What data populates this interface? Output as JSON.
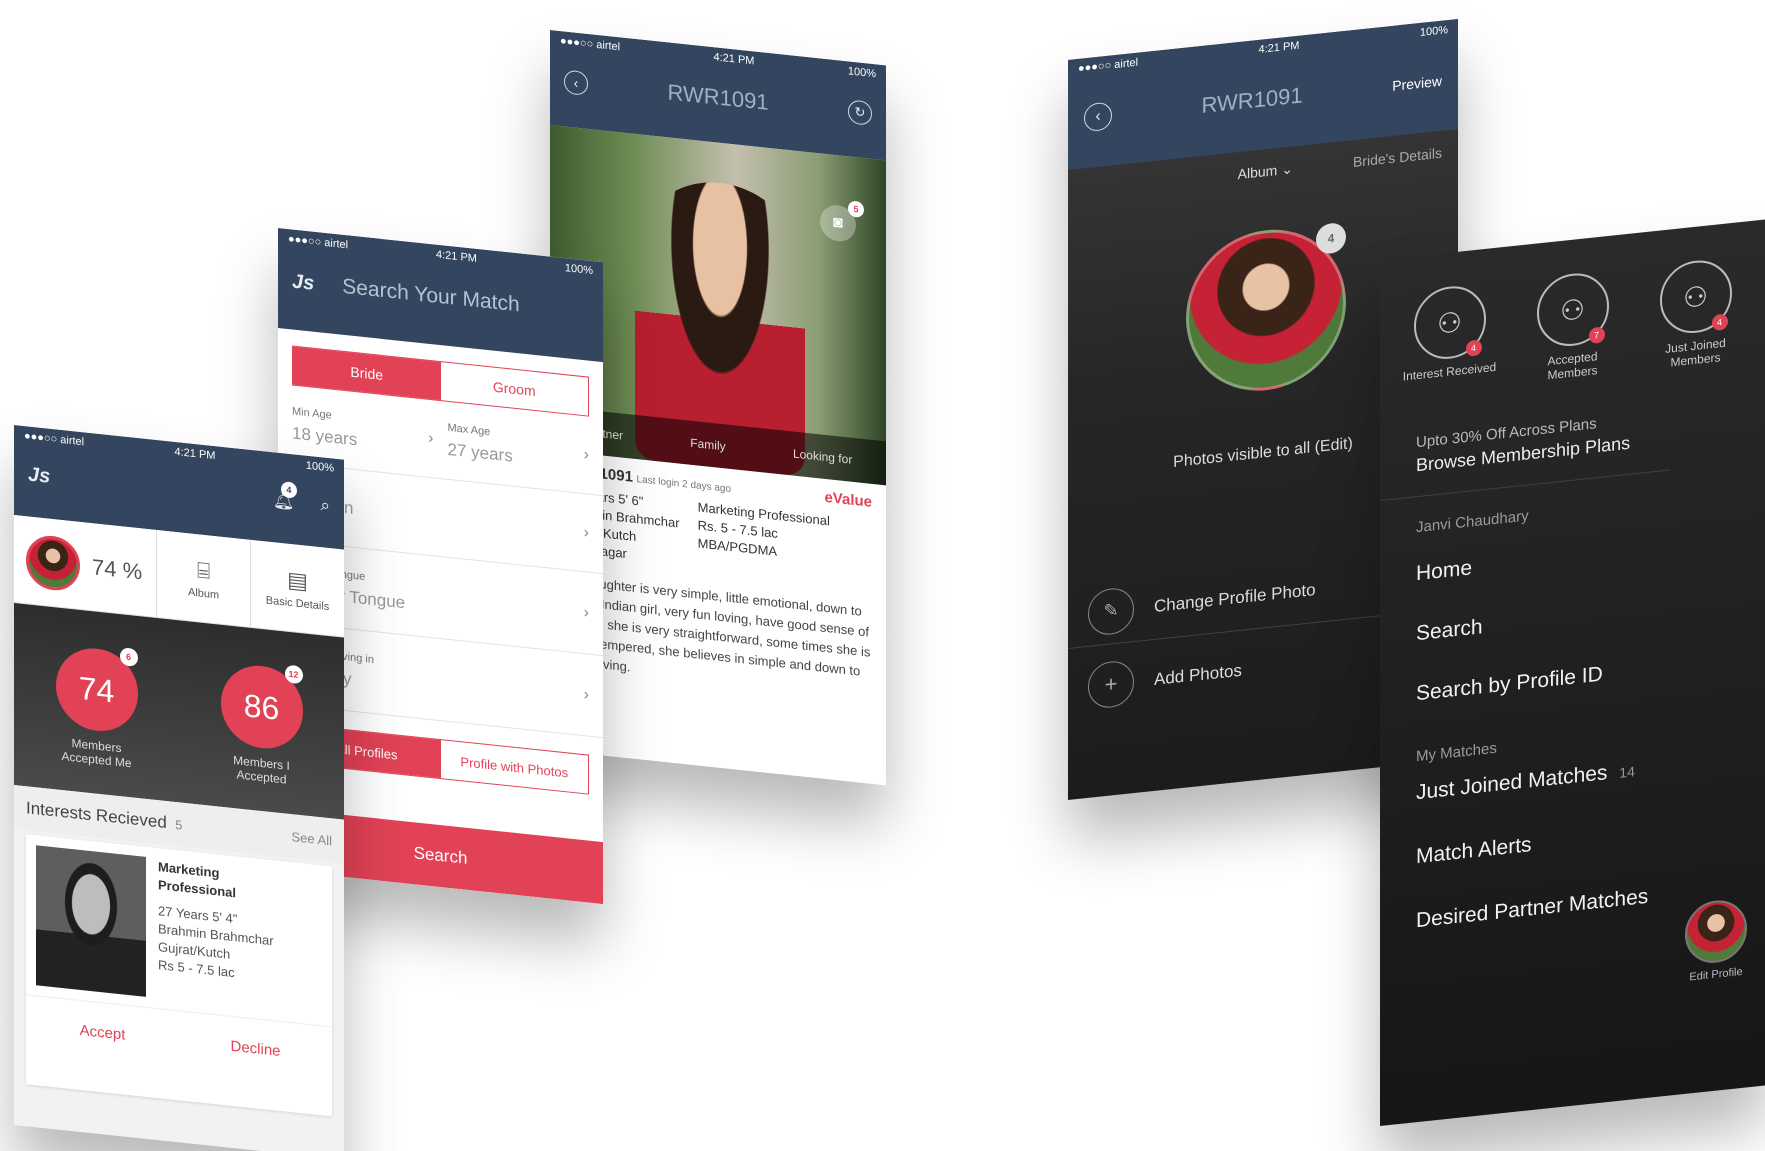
{
  "status": {
    "carrier": "●●●○○ airtel",
    "time": "4:21 PM",
    "battery": "100%"
  },
  "dashboard": {
    "logo": "Js",
    "notif_count": "4",
    "completion": "74 %",
    "album_label": "Album",
    "basic_label": "Basic Details",
    "accepted_me": {
      "value": "74",
      "badge": "6",
      "label": "Members Accepted Me"
    },
    "i_accepted": {
      "value": "86",
      "badge": "12",
      "label": "Members I Accepted"
    },
    "interests_title": "Interests Recieved",
    "interests_count": "5",
    "see_all": "See All",
    "card": {
      "profession": "Marketing Professional",
      "line1": "27 Years   5' 4\"",
      "line2": "Brahmin Brahmchar",
      "line3": "Gujrat/Kutch",
      "line4": "Rs 5 - 7.5 lac",
      "accept": "Accept",
      "decline": "Decline"
    }
  },
  "search": {
    "logo": "Js",
    "title": "Search Your Match",
    "bride": "Bride",
    "groom": "Groom",
    "min_age_label": "Min Age",
    "min_age_value": "18 years",
    "max_age_label": "Max Age",
    "max_age_value": "27 years",
    "religion": "Religion",
    "tongue_label": "Mother Tongue",
    "tongue_value": "Mother Tongue",
    "country_label": "Country Living in",
    "country_value": "Country",
    "all_profiles": "All Profiles",
    "with_photos": "Profile with Photos",
    "search_button": "Search"
  },
  "profile": {
    "id": "RWR1091",
    "photo_count": "5",
    "tabs": [
      "Partner",
      "Family",
      "Looking for"
    ],
    "id_line": "RWR1091",
    "last_login": "Last login 2 days ago",
    "evalue": "eValue",
    "left": [
      "27 Years  5' 6\"",
      "Brahmin Brahmchar",
      "Gujrat/Kutch",
      "Bhavnagar"
    ],
    "right": [
      "Marketing Professional",
      "Rs. 5 - 7.5 lac",
      "MBA/PGDMA"
    ],
    "about": "My daughter is very simple, little emotional, down to earth, Indian girl, very fun loving, have good sense of humor, she is very straightforward, some times she is short tempered, she believes in simple and down to earth living."
  },
  "album": {
    "id": "RWR1091",
    "preview": "Preview",
    "album_tab": "Album",
    "details_tab": "Bride's Details",
    "photo_count": "4",
    "visibility": "Photos visible to all (Edit)",
    "change": "Change Profile Photo",
    "add": "Add Photos"
  },
  "menu": {
    "icons": [
      {
        "label": "Interest Received",
        "count": "4"
      },
      {
        "label": "Accepted Members",
        "count": "7"
      },
      {
        "label": "Just Joined Members",
        "count": "4"
      }
    ],
    "offer": "Upto 30% Off Across Plans",
    "browse": "Browse Membership Plans",
    "user": "Janvi Chaudhary",
    "home": "Home",
    "search": "Search",
    "search_id": "Search by Profile ID",
    "section": "My Matches",
    "just_joined": "Just Joined Matches",
    "just_joined_count": "14",
    "alerts": "Match Alerts",
    "desired": "Desired Partner Matches",
    "edit": "Edit Profile"
  }
}
